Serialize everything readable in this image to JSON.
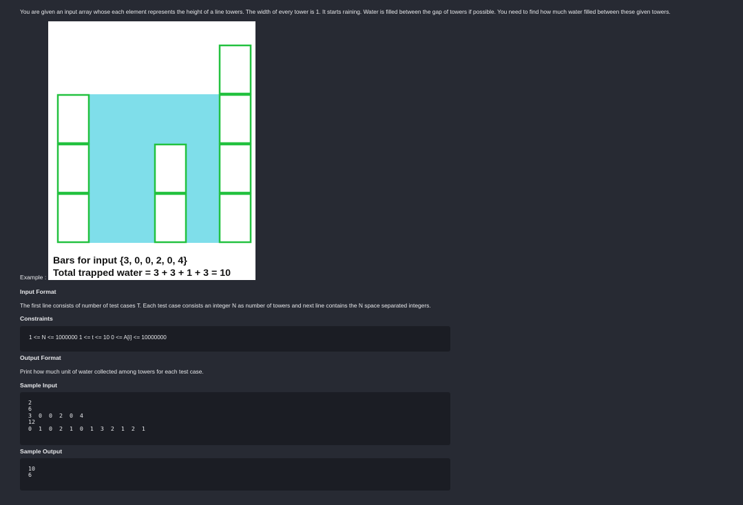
{
  "intro": "You are given an input array whose each element represents the height of a line towers. The width of every tower is 1. It starts raining. Water is filled between the gap of towers if possible. You need to find how much water filled between these given towers.",
  "example": {
    "label": "Example :",
    "figure": {
      "input_heights": [
        3,
        0,
        0,
        2,
        0,
        4
      ],
      "water_per_column": [
        0,
        3,
        3,
        1,
        3,
        0
      ],
      "caption_line1": "Bars for input {3, 0, 0, 2, 0, 4}",
      "caption_line2": "Total trapped water = 3 + 3 + 1 + 3 = 10",
      "colors": {
        "tower_outline": "#22c13f",
        "water": "#7fdeea",
        "tower_fill": "#ffffff"
      }
    }
  },
  "sections": {
    "input_format_heading": "Input Format",
    "input_format_text": "The first line consists of number of test cases T. Each test case consists an integer N as number of towers and next line contains the N space separated integers.",
    "constraints_heading": "Constraints",
    "constraints_text": "1 <= N <= 1000000 1 <= t <= 10 0 <= A[i] <= 10000000",
    "output_format_heading": "Output Format",
    "output_format_text": "Print how much unit of water collected among towers for each test case.",
    "sample_input_heading": "Sample Input",
    "sample_input": "2\n6\n3  0  0  2  0  4\n12\n0  1  0  2  1  0  1  3  2  1  2  1",
    "sample_output_heading": "Sample Output",
    "sample_output": "10\n6"
  },
  "theme": {
    "background": "#272a33",
    "code_background": "#1b1d24",
    "text": "#e6e7ea"
  }
}
